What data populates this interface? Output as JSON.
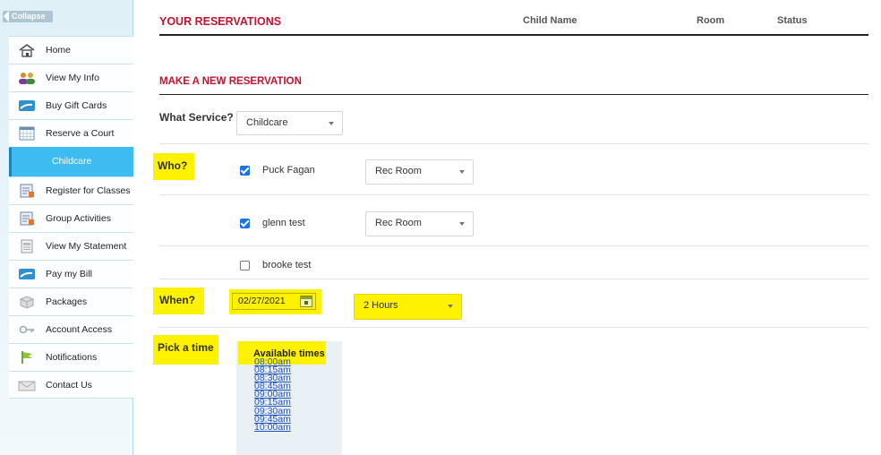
{
  "sidebar": {
    "collapse_label": "Collapse",
    "items": [
      {
        "label": "Home",
        "icon": "home-icon"
      },
      {
        "label": "View My Info",
        "icon": "users-icon"
      },
      {
        "label": "Buy Gift Cards",
        "icon": "card-icon"
      },
      {
        "label": "Reserve a Court",
        "icon": "calendar-icon"
      },
      {
        "label": "Childcare",
        "icon": "",
        "active": true
      },
      {
        "label": "Register for Classes",
        "icon": "register-icon"
      },
      {
        "label": "Group Activities",
        "icon": "group-activities-icon"
      },
      {
        "label": "View My Statement",
        "icon": "statement-icon"
      },
      {
        "label": "Pay my Bill",
        "icon": "card-icon"
      },
      {
        "label": "Packages",
        "icon": "package-icon"
      },
      {
        "label": "Account Access",
        "icon": "key-icon"
      },
      {
        "label": "Notifications",
        "icon": "flag-icon"
      },
      {
        "label": "Contact Us",
        "icon": "envelope-icon"
      }
    ]
  },
  "reservations": {
    "title": "YOUR RESERVATIONS",
    "columns": [
      "Child Name",
      "Room",
      "Status"
    ]
  },
  "make": {
    "title": "MAKE A NEW RESERVATION",
    "service_label": "What Service?",
    "service_value": "Childcare",
    "who_label": "Who?",
    "children": [
      {
        "name": "Puck Fagan",
        "checked": true,
        "room": "Rec Room"
      },
      {
        "name": "glenn test",
        "checked": true,
        "room": "Rec Room"
      },
      {
        "name": "brooke test",
        "checked": false
      }
    ],
    "when_label": "When?",
    "date_value": "02/27/2021",
    "duration_value": "2 Hours",
    "pick_label": "Pick a time",
    "times_title": "Available times",
    "times": [
      "08:00am",
      "08:15am",
      "08:30am",
      "08:45am",
      "09:00am",
      "09:15am",
      "09:30am",
      "09:45am",
      "10:00am"
    ]
  },
  "colors": {
    "accent": "#c4122f",
    "highlight": "#fff200",
    "active_nav": "#3cbcf0"
  }
}
